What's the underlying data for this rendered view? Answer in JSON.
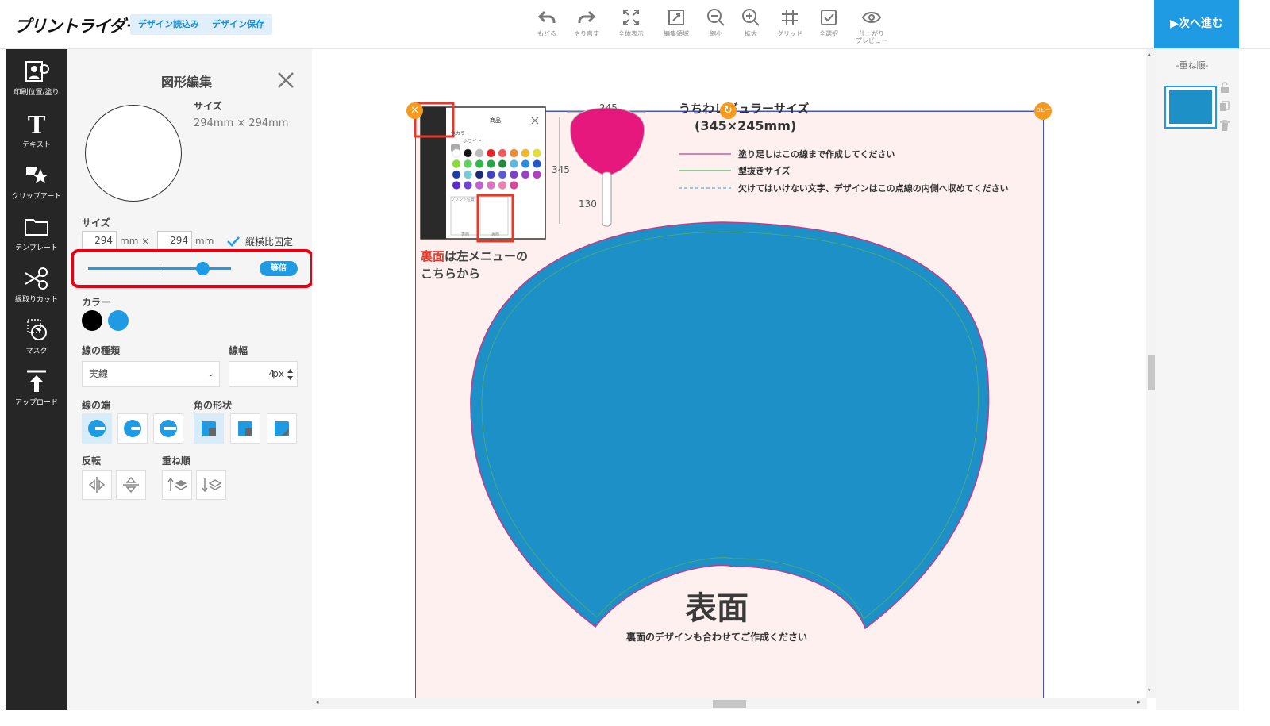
{
  "header": {
    "logo": "プリントライダー",
    "load_design": "デザイン読込み",
    "save_design": "デザイン保存",
    "next": "▶次へ進む",
    "tools": [
      {
        "label": "もどる",
        "icon": "undo-icon"
      },
      {
        "label": "やり直す",
        "icon": "redo-icon"
      },
      {
        "label": "全体表示",
        "icon": "fit-all-icon"
      },
      {
        "label": "編集領域",
        "icon": "edit-area-icon"
      },
      {
        "label": "縮小",
        "icon": "zoom-out-icon"
      },
      {
        "label": "拡大",
        "icon": "zoom-in-icon"
      },
      {
        "label": "グリッド",
        "icon": "grid-icon"
      },
      {
        "label": "全選択",
        "icon": "select-all-icon"
      },
      {
        "label": "仕上がり",
        "label2": "プレビュー",
        "icon": "preview-eye-icon"
      }
    ]
  },
  "sidebar": {
    "items": [
      {
        "label": "印刷位置/塗り",
        "icon": "print-position-icon"
      },
      {
        "label": "テキスト",
        "icon": "text-icon"
      },
      {
        "label": "クリップアート",
        "icon": "clipart-icon"
      },
      {
        "label": "テンプレート",
        "icon": "template-folder-icon"
      },
      {
        "label": "縁取りカット",
        "icon": "scissors-icon"
      },
      {
        "label": "マスク",
        "icon": "mask-icon"
      },
      {
        "label": "アップロード",
        "icon": "upload-icon"
      }
    ]
  },
  "panel": {
    "title": "図形編集",
    "size_label": "サイズ",
    "size_value": "294mm × 294mm",
    "size_section": "サイズ",
    "width": "294",
    "height": "294",
    "unit_x": "mm ×",
    "unit_y": "mm",
    "keep_ratio": "縦横比固定",
    "keep_ratio_checked": true,
    "scale_button": "等倍",
    "scale_level": 0.8,
    "color_label": "カラー",
    "colors": [
      "#000000",
      "#1e9be3"
    ],
    "line_type_label": "線の種類",
    "line_type": "実線",
    "line_width_label": "線幅",
    "line_width": "4",
    "line_width_unit": "px",
    "line_end_label": "線の端",
    "corner_label": "角の形状",
    "flip_label": "反転",
    "order_label": "重ね順"
  },
  "canvas": {
    "product_title": "うちわレギュラーサイズ",
    "product_size": "(345×245mm)",
    "dim_width": "245",
    "dim_height": "345",
    "dim_handle": "130",
    "legend": [
      "塗り足しはこの線まで作成してください",
      "型抜きサイズ",
      "欠けてはいけない文字、デザインはこの点線の内側へ収めてください"
    ],
    "back_note_highlight": "裏面",
    "back_note_rest": "は左メニューの",
    "back_note_line2": "こちらから",
    "front_label": "表面",
    "front_note": "裏面のデザインも合わせてご作成ください",
    "copy_handle": "コピー",
    "mini_panel_title": "商品",
    "mini_color_label": "色カラー",
    "mini_white": "ホワイト",
    "mini_print_pos": "プリント位置",
    "mini_front": "表面",
    "mini_back": "裏面"
  },
  "layers": {
    "title": "-重ね順-"
  }
}
